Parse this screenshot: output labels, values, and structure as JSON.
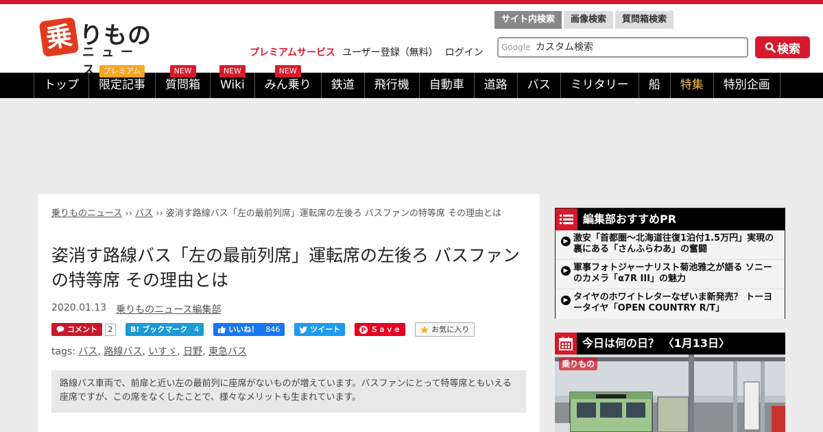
{
  "logo": {
    "mark": "乗",
    "main": "りもの",
    "sub": "ニュース"
  },
  "header_links": {
    "premium": "プレミアムサービス",
    "register": "ユーザー登録（無料）",
    "login": "ログイン"
  },
  "search": {
    "tabs": [
      "サイト内検索",
      "画像検索",
      "質問箱検索"
    ],
    "google_label": "Google",
    "placeholder": "カスタム検索",
    "button_label": "検索"
  },
  "nav": [
    {
      "label": "トップ",
      "badge": ""
    },
    {
      "label": "限定記事",
      "badge": "プレミアム"
    },
    {
      "label": "質問箱",
      "badge": "NEW"
    },
    {
      "label": "Wiki",
      "badge": "NEW"
    },
    {
      "label": "みん乗り",
      "badge": "NEW"
    },
    {
      "label": "鉄道",
      "badge": ""
    },
    {
      "label": "飛行機",
      "badge": ""
    },
    {
      "label": "自動車",
      "badge": ""
    },
    {
      "label": "道路",
      "badge": ""
    },
    {
      "label": "バス",
      "badge": ""
    },
    {
      "label": "ミリタリー",
      "badge": ""
    },
    {
      "label": "船",
      "badge": ""
    },
    {
      "label": "特集",
      "badge": ""
    },
    {
      "label": "特別企画",
      "badge": ""
    }
  ],
  "article": {
    "breadcrumb": [
      "乗りものニュース",
      "バス",
      "姿消す路線バス「左の最前列席」運転席の左後ろ バスファンの特等席 その理由とは"
    ],
    "breadcrumb_sep": "››",
    "title": "姿消す路線バス「左の最前列席」運転席の左後ろ バスファンの特等席 その理由とは",
    "date": "2020.01.13",
    "author": "乗りものニュース編集部",
    "share": {
      "comment_label": "コメント",
      "comment_count": "2",
      "hatena_label": "B! ブックマーク",
      "hatena_count": "4",
      "fb_label": "いいね！",
      "fb_count": "846",
      "tw_label": "ツイート",
      "pin_label": "Ｓａｖｅ",
      "fav_label": "お気に入り"
    },
    "tags_label": "tags:",
    "tags": [
      "バス",
      "路線バス",
      "いすゞ",
      "日野",
      "東急バス"
    ],
    "lead": "路線バス車両で、前扉と近い左の最前列に座席がないものが増えています。バスファンにとって特等席ともいえる座席ですが、この席をなくしたことで、様々なメリットも生まれています。"
  },
  "sidebar": {
    "pr_title": "編集部おすすめPR",
    "pr_items": [
      "激安「首都圏～北海道往復1泊付1.5万円」実現の裏にある「さんふらわあ」の奮闘",
      "軍事フォトジャーナリスト菊池雅之が語る ソニーのカメラ「α7R III」の魅力",
      "タイヤのホワイトレターなぜいま新発売？ トーヨータイヤ「OPEN COUNTRY R/T」"
    ],
    "today_title": "今日は何の日？ 〈1月13日〉",
    "today_watermark": "乗りもの"
  }
}
